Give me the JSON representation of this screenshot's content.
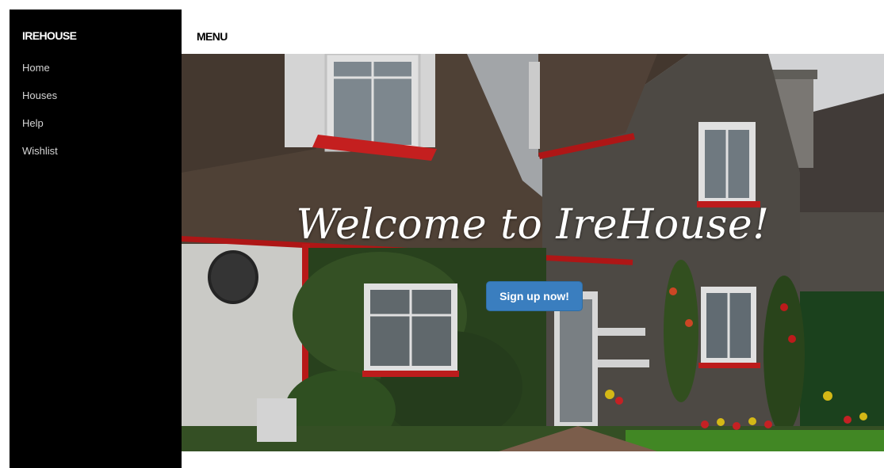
{
  "sidebar": {
    "brand": "IREHOUSE",
    "items": [
      {
        "label": "Home"
      },
      {
        "label": "Houses"
      },
      {
        "label": "Help"
      },
      {
        "label": "Wishlist"
      }
    ]
  },
  "topbar": {
    "menu_label": "MENU"
  },
  "hero": {
    "title": "Welcome to IreHouse!",
    "cta_label": "Sign up now!",
    "image": "house-photo"
  },
  "colors": {
    "sidebar_bg": "#000000",
    "cta_bg": "#3a7ebf",
    "trim_red": "#d61f1f"
  }
}
